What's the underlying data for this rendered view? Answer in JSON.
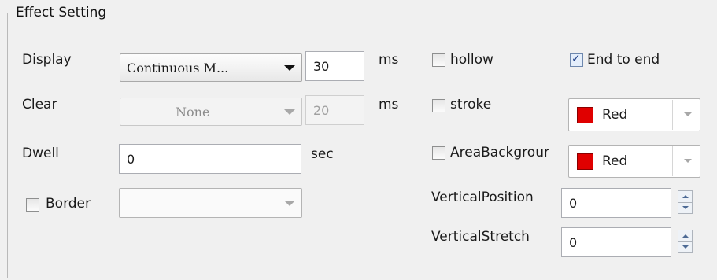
{
  "group": {
    "title": "Effect Setting"
  },
  "display": {
    "label": "Display",
    "mode": "Continuous M...",
    "speed": "30",
    "unit": "ms"
  },
  "clear": {
    "label": "Clear",
    "mode": "None",
    "speed": "20",
    "unit": "ms"
  },
  "dwell": {
    "label": "Dwell",
    "value": "0",
    "unit": "sec"
  },
  "border": {
    "label": "Border",
    "checked": false,
    "value": ""
  },
  "hollow": {
    "label": "hollow",
    "checked": false
  },
  "end_to_end": {
    "label": "End to end",
    "checked": true
  },
  "stroke": {
    "label": "stroke",
    "checked": false,
    "color": "Red",
    "swatch": "#e00000"
  },
  "area_background": {
    "label": "AreaBackgrour",
    "checked": false,
    "color": "Red",
    "swatch": "#e00000"
  },
  "vertical_position": {
    "label": "VerticalPosition",
    "value": "0"
  },
  "vertical_stretch": {
    "label": "VerticalStretch",
    "value": "0"
  }
}
